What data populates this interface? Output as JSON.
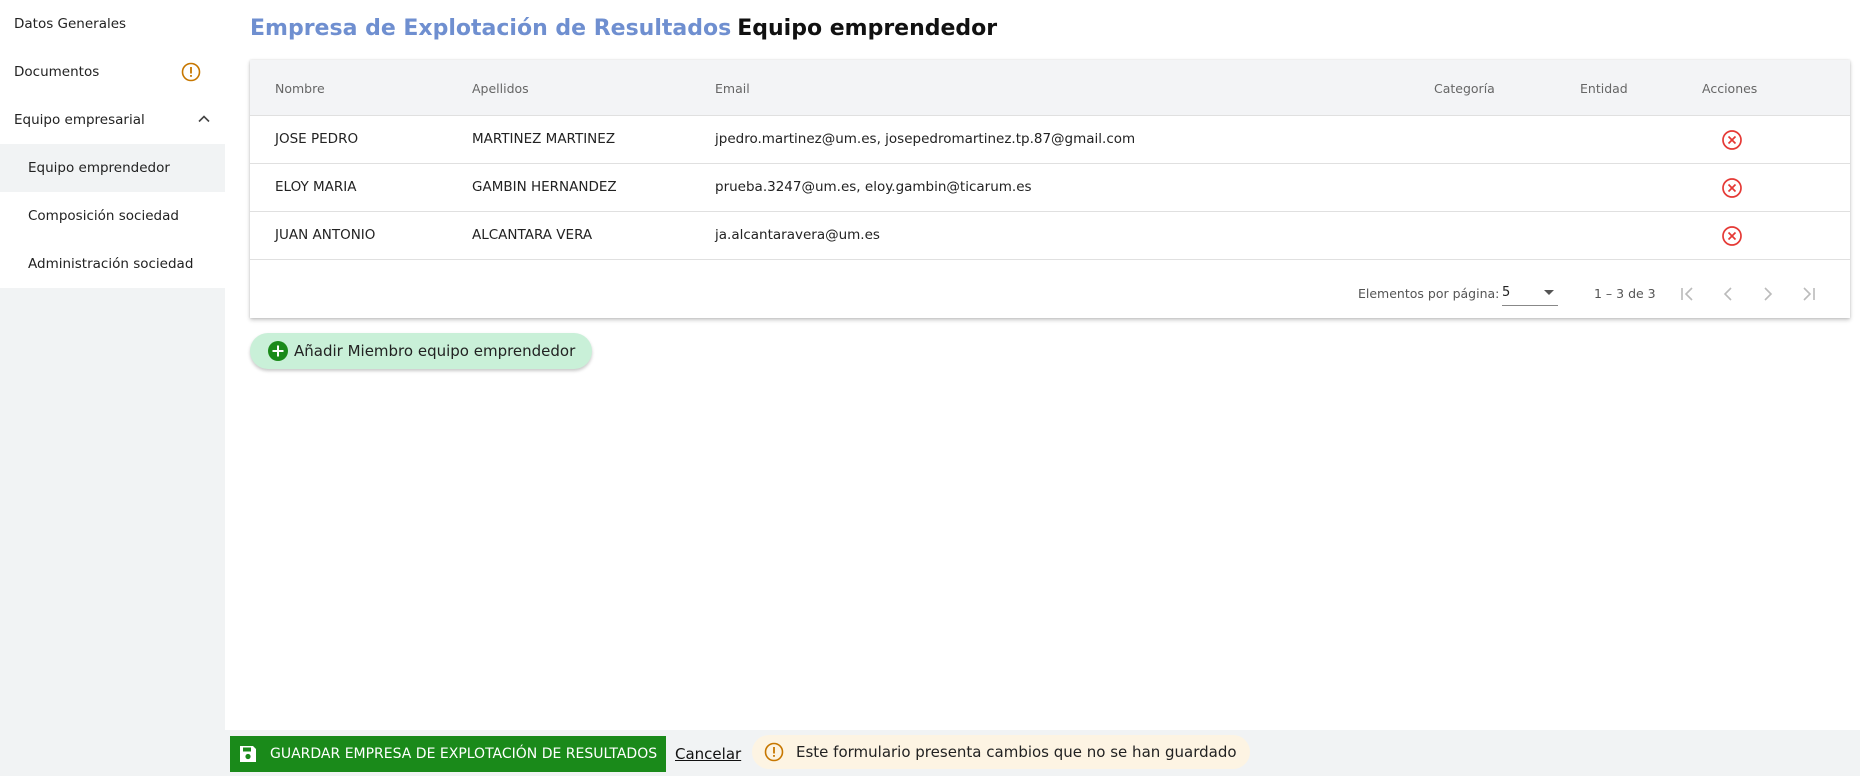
{
  "sidebar": {
    "items": [
      {
        "label": "Datos Generales"
      },
      {
        "label": "Documentos"
      },
      {
        "label": "Equipo empresarial"
      },
      {
        "label": "Equipo emprendedor"
      },
      {
        "label": "Composición sociedad"
      },
      {
        "label": "Administración sociedad"
      }
    ]
  },
  "header": {
    "section": "Empresa de Explotación de Resultados",
    "title": "Equipo emprendedor"
  },
  "table": {
    "columns": [
      "Nombre",
      "Apellidos",
      "Email",
      "Categoría",
      "Entidad",
      "Acciones"
    ],
    "rows": [
      {
        "nombre": "JOSE PEDRO",
        "apellidos": "MARTINEZ MARTINEZ",
        "email": "jpedro.martinez@um.es, josepedromartinez.tp.87@gmail.com",
        "categoria": "",
        "entidad": ""
      },
      {
        "nombre": "ELOY MARIA",
        "apellidos": "GAMBIN HERNANDEZ",
        "email": "prueba.3247@um.es, eloy.gambin@ticarum.es",
        "categoria": "",
        "entidad": ""
      },
      {
        "nombre": "JUAN ANTONIO",
        "apellidos": "ALCANTARA VERA",
        "email": "ja.alcantaravera@um.es",
        "categoria": "",
        "entidad": ""
      }
    ]
  },
  "paginator": {
    "items_label": "Elementos por página:",
    "page_size": "5",
    "range": "1 – 3 de 3"
  },
  "actions": {
    "add_label": "Añadir Miembro equipo emprendedor"
  },
  "footer": {
    "save_label": "GUARDAR EMPRESA DE EXPLOTACIÓN DE RESULTADOS",
    "cancel_label": "Cancelar",
    "unsaved_message": "Este formulario presenta cambios que no se han guardado"
  },
  "icons": {
    "warning": "warning-circle-icon",
    "chevron": "chevron-up-icon",
    "delete": "cancel-circle-icon",
    "add": "add-circle-icon",
    "save": "floppy-disk-icon"
  },
  "colors": {
    "accent_title": "#6f8fd0",
    "save_button": "#1a8a1a",
    "add_button": "#c9f0d8",
    "delete_icon": "#e53935",
    "warning_icon": "#c77700",
    "unsaved_bg": "#fdf4e3"
  }
}
